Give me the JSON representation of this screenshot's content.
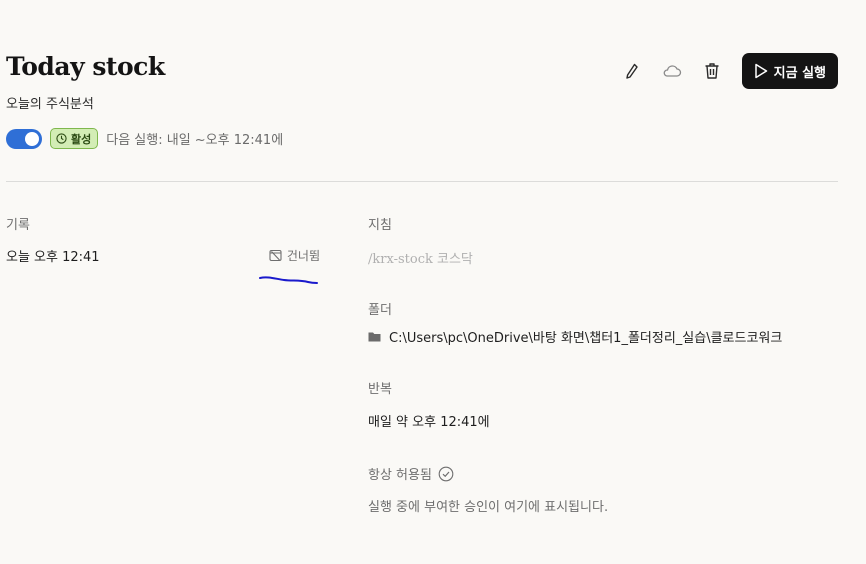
{
  "header": {
    "title": "Today stock",
    "subtitle": "오늘의 주식분석"
  },
  "toolbar": {
    "edit_icon": "pencil-icon",
    "cloud_icon": "cloud-icon",
    "delete_icon": "trash-icon",
    "run_label": "지금 실행"
  },
  "status": {
    "enabled": true,
    "badge_label": "활성",
    "next_run": "다음 실행: 내일 ~오후 12:41에"
  },
  "history": {
    "label": "기록",
    "items": [
      {
        "time": "오늘 오후 12:41",
        "status": "건너뜀"
      }
    ]
  },
  "details": {
    "prompt_label": "지침",
    "prompt_text": "/krx-stock 코스닥",
    "folder_label": "폴더",
    "folder_path": "C:\\Users\\pc\\OneDrive\\바탕 화면\\챕터1_폴더정리_실습\\클로드코워크",
    "repeat_label": "반복",
    "repeat_text": "매일 약 오후 12:41에",
    "permission_label": "항상 허용됨",
    "permission_desc": "실행 중에 부여한 승인이 여기에 표시됩니다."
  },
  "colors": {
    "background": "#faf9f6",
    "toggle_on": "#2f6fd6",
    "badge_bg": "#d3edb5",
    "badge_border": "#7fb84d",
    "run_button": "#141414",
    "annotation_scribble": "#1a1acc"
  }
}
